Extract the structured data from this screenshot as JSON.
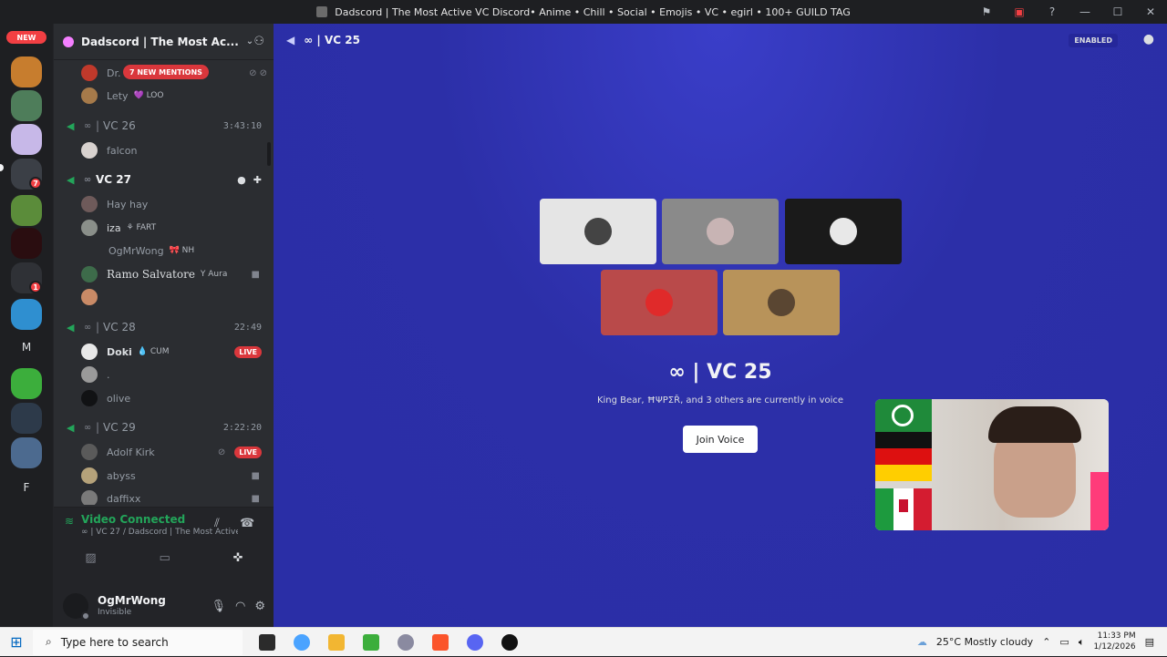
{
  "window": {
    "title": "Dadscord | The Most Active VC Discord• Anime • Chill • Social • Emojis • VC • egirl • 100+ GUILD TAG"
  },
  "rail": {
    "new_label": "NEW",
    "badges": [
      "7",
      "1"
    ],
    "letters": [
      "M",
      "F"
    ]
  },
  "server": {
    "name": "Dadscord | The Most Ac..."
  },
  "channels": {
    "mentions_label": "7 NEW MENTIONS",
    "top_members": [
      {
        "name": "Dr.",
        "tag": "NUL"
      },
      {
        "name": "Lety",
        "tag": "💜 LOO"
      }
    ],
    "vc26": {
      "name": "VC 26",
      "timer": "3:43:10",
      "members": [
        {
          "name": "falcon"
        }
      ]
    },
    "vc27": {
      "name": "VC 27",
      "members": [
        {
          "name": "Hay hay",
          "tag": ""
        },
        {
          "name": "iza",
          "tag": "⚘ FART"
        },
        {
          "name": "OgMrWong",
          "tag": "🎀 NH"
        },
        {
          "name": "Ramo Salvatore",
          "tag": "Y Aura"
        },
        {
          "name": "",
          "tag": ""
        }
      ]
    },
    "vc28": {
      "name": "VC 28",
      "timer": "22:49",
      "members": [
        {
          "name": "Doki",
          "tag": "💧 CUM",
          "live": "LIVE"
        },
        {
          "name": ".",
          "tag": ""
        },
        {
          "name": "olive",
          "tag": ""
        }
      ]
    },
    "vc29": {
      "name": "VC 29",
      "timer": "2:22:20",
      "members": [
        {
          "name": "Adolf Kirk",
          "live": "LIVE"
        },
        {
          "name": "abyss"
        },
        {
          "name": "daffixx"
        }
      ]
    }
  },
  "voice_panel": {
    "status": "Video Connected",
    "sub": "∞ | VC 27 / Dadscord | The Most Active ..."
  },
  "user": {
    "name": "OgMrWong",
    "status": "Invisible"
  },
  "main": {
    "channel": "∞ | VC 25",
    "enabled_label": "ENABLED",
    "title": "∞ | VC 25",
    "subtitle": "King Bear, ĦΨΡΣŘ, and 3 others are currently in voice",
    "join_label": "Join Voice"
  },
  "taskbar": {
    "search_placeholder": "Type here to search",
    "weather": "25°C  Mostly cloudy",
    "time": "11:33 PM",
    "date": "1/12/2026"
  },
  "colors": {
    "accent_green": "#23a55a",
    "live_red": "#da373c",
    "main_bg": "#2c2fa8"
  }
}
